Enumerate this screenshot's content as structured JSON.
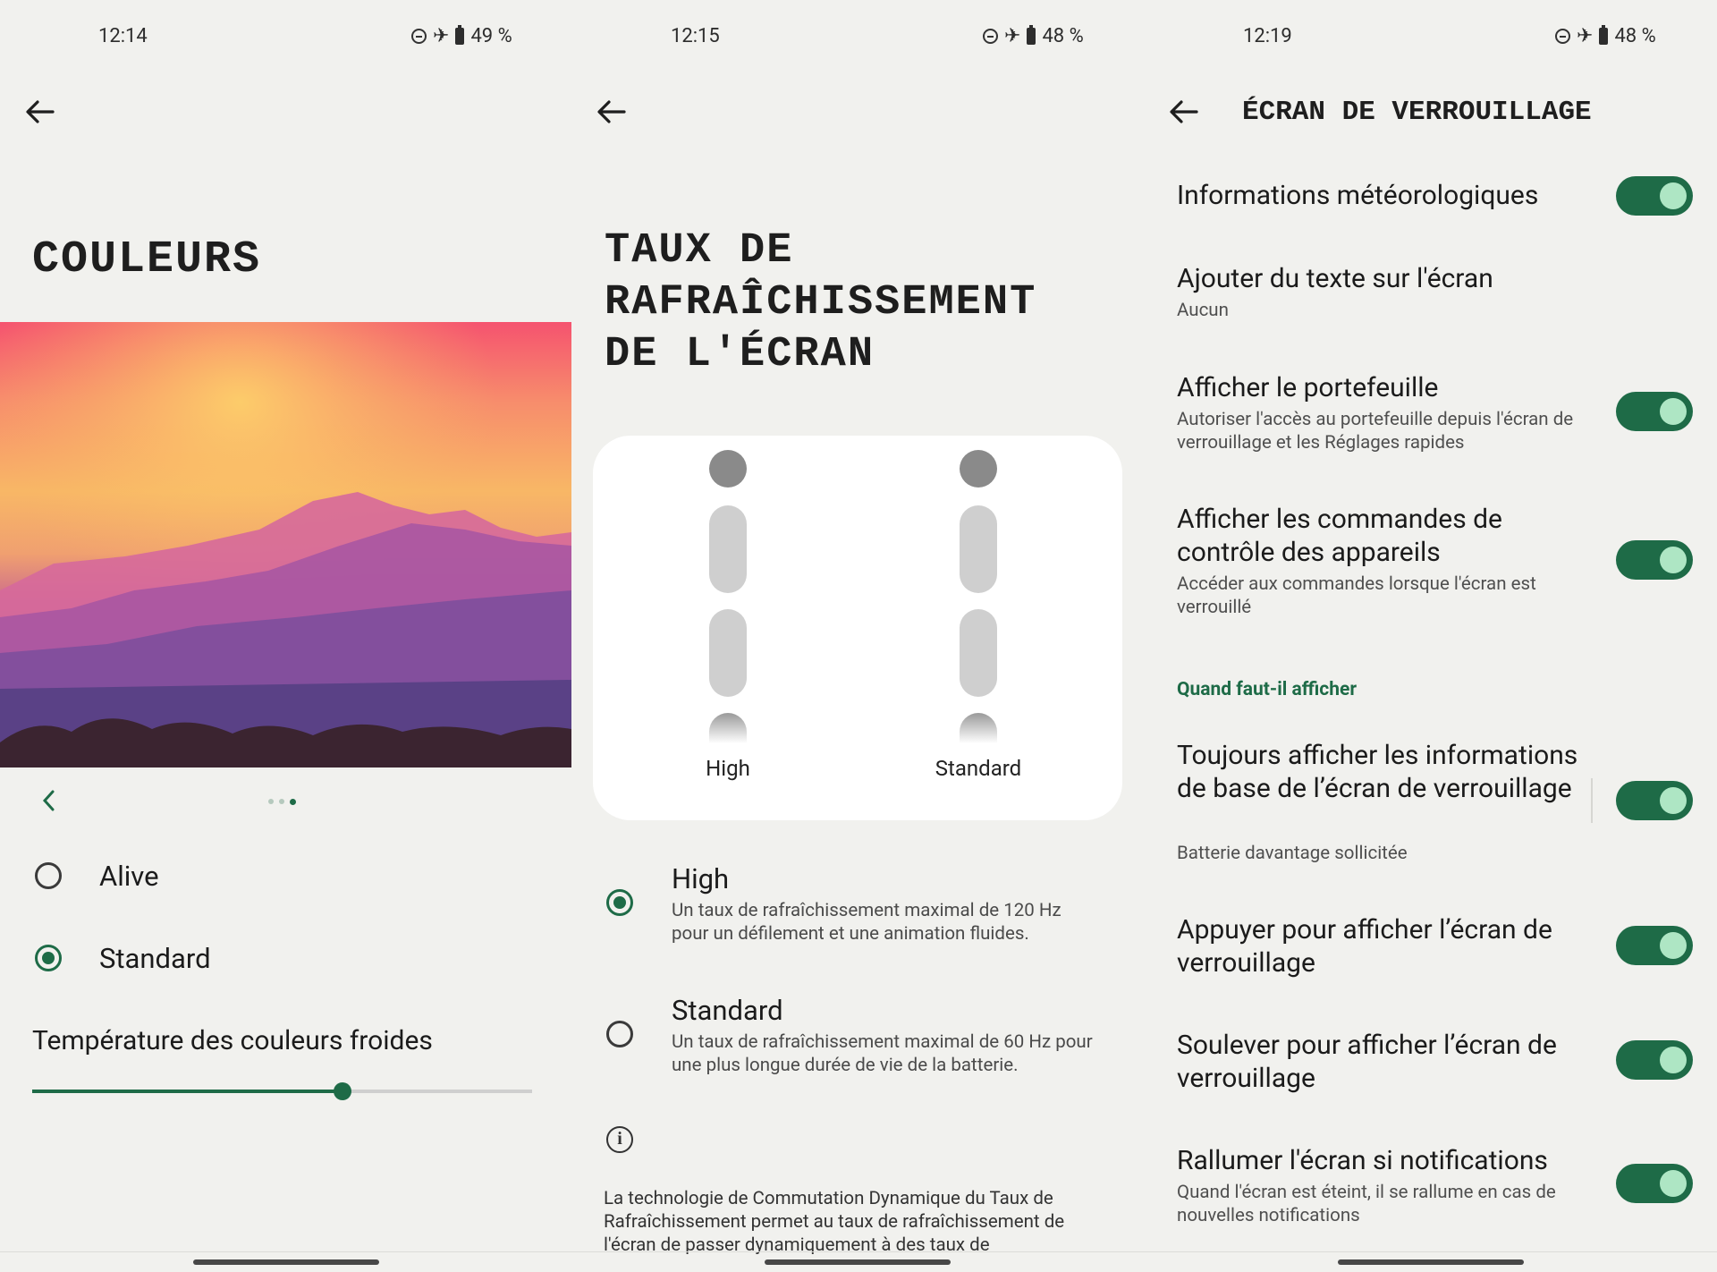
{
  "screen1": {
    "status": {
      "time": "12:14",
      "battery": "49 %"
    },
    "title": "COULEURS",
    "options": [
      {
        "label": "Alive",
        "selected": false
      },
      {
        "label": "Standard",
        "selected": true
      }
    ],
    "temperature_label": "Température des couleurs froides",
    "temperature_value": 0.62,
    "carousel_page": 3,
    "carousel_pages": 3
  },
  "screen2": {
    "status": {
      "time": "12:15",
      "battery": "48 %"
    },
    "title_lines": [
      "TAUX DE",
      "RAFRAÎCHISSEMENT",
      "DE L'ÉCRAN"
    ],
    "preview_labels": [
      "High",
      "Standard"
    ],
    "options": [
      {
        "title": "High",
        "desc": "Un taux de rafraîchissement maximal de 120 Hz pour un défilement et une animation fluides.",
        "selected": true
      },
      {
        "title": "Standard",
        "desc": "Un taux de rafraîchissement maximal de 60 Hz pour une plus longue durée de vie de la batterie.",
        "selected": false
      }
    ],
    "info_text": "La technologie de Commutation Dynamique du Taux de Rafraîchissement permet au taux de rafraîchissement de l'écran de passer dynamiquement à des taux de"
  },
  "screen3": {
    "status": {
      "time": "12:19",
      "battery": "48 %"
    },
    "title": "ÉCRAN DE VERROUILLAGE",
    "rows": [
      {
        "title": "Informations météorologiques",
        "sub": "",
        "toggle": true
      },
      {
        "title": "Ajouter du texte sur l'écran",
        "sub": "Aucun",
        "toggle": null
      },
      {
        "title": "Afficher le portefeuille",
        "sub": "Autoriser l'accès au portefeuille depuis l'écran de verrouillage et les Réglages rapides",
        "toggle": true
      },
      {
        "title": "Afficher les commandes de contrôle des appareils",
        "sub": "Accéder aux commandes lorsque l'écran est verrouillé",
        "toggle": true
      },
      {
        "title": "Toujours afficher les informations de base de l’écran de verrouillage",
        "sub": "Batterie davantage sollicitée",
        "toggle": true
      },
      {
        "title": "Appuyer pour afficher l’écran de verrouillage",
        "sub": "",
        "toggle": true
      },
      {
        "title": "Soulever pour afficher l’écran de verrouillage",
        "sub": "",
        "toggle": true
      },
      {
        "title": "Rallumer l'écran si notifications",
        "sub": "Quand l'écran est éteint, il se rallume en cas de nouvelles notifications",
        "toggle": true
      }
    ],
    "section_heading": "Quand faut-il afficher"
  },
  "colors": {
    "accent": "#1e6b47",
    "toggle_thumb": "#aee6c4",
    "background": "#f1f1ee"
  }
}
